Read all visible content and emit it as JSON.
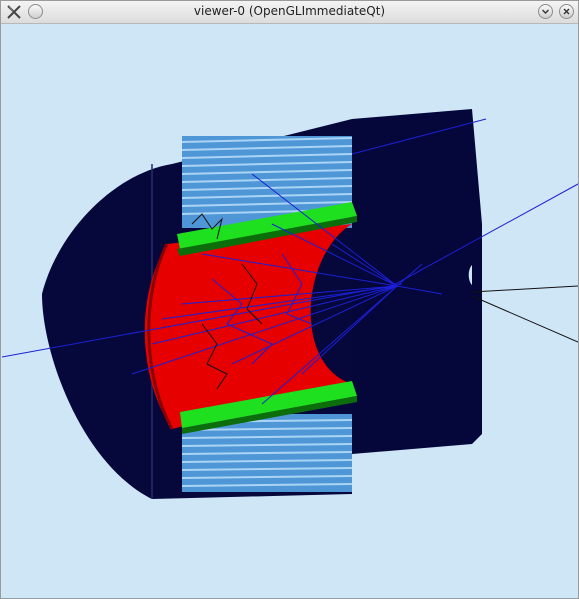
{
  "window": {
    "title": "viewer-0 (OpenGLImmediateQt)",
    "background_color": "#cfe6f7",
    "controls": [
      "menu-icon",
      "shade-button",
      "minimize-button",
      "close-button"
    ]
  },
  "scene": {
    "colors": {
      "dark_body": "#05063a",
      "absorber_layers": "#5aa9e6",
      "green_bars": "#1ee01e",
      "red_volume": "#e60000",
      "blue_tracks": "#1b20d6",
      "black_tracks": "#111111"
    }
  }
}
